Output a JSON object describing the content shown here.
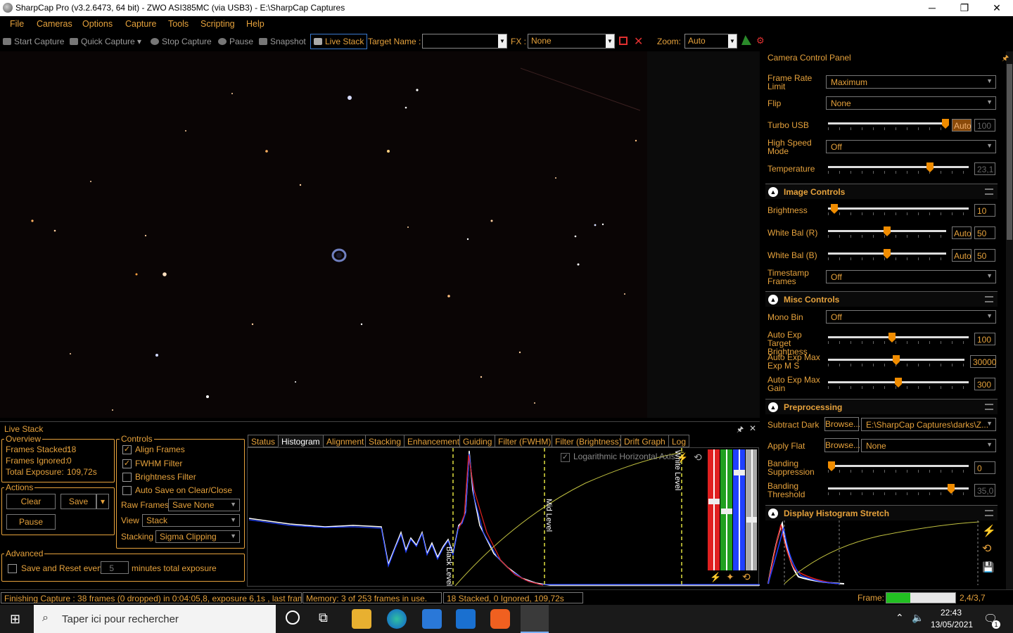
{
  "window": {
    "title": "SharpCap Pro (v3.2.6473, 64 bit) - ZWO ASI385MC (via USB3) - E:\\SharpCap Captures",
    "minimize": "─",
    "maximize": "❐",
    "close": "✕"
  },
  "menu": [
    "File",
    "Cameras",
    "Options",
    "Capture",
    "Tools",
    "Scripting",
    "Help"
  ],
  "toolbar": {
    "start_capture": "Start Capture",
    "quick_capture": "Quick Capture",
    "stop_capture": "Stop Capture",
    "pause": "Pause",
    "snapshot": "Snapshot",
    "live_stack": "Live Stack",
    "target_name_label": "Target Name :",
    "target_name_value": "",
    "fx_label": "FX :",
    "fx_value": "None",
    "zoom_label": "Zoom:",
    "zoom_value": "Auto"
  },
  "camera_panel": {
    "title": "Camera Control Panel",
    "frame_rate_label": "Frame Rate Limit",
    "frame_rate_value": "Maximum",
    "flip_label": "Flip",
    "flip_value": "None",
    "turbo_usb_label": "Turbo USB",
    "turbo_usb_auto": "Auto",
    "turbo_usb_value": "100",
    "turbo_usb_level": 0.95,
    "high_speed_label": "High Speed Mode",
    "high_speed_value": "Off",
    "temperature_label": "Temperature",
    "temperature_value": "23,1",
    "temperature_level": 0.73
  },
  "image_controls": {
    "title": "Image Controls",
    "brightness_label": "Brightness",
    "brightness_value": "10",
    "brightness_level": 0.04,
    "wb_r_label": "White Bal (R)",
    "wb_r_auto": "Auto",
    "wb_r_value": "50",
    "wb_b_label": "White Bal (B)",
    "wb_b_auto": "Auto",
    "wb_b_value": "50",
    "timestamp_label": "Timestamp Frames",
    "timestamp_value": "Off"
  },
  "misc_controls": {
    "title": "Misc Controls",
    "mono_bin_label": "Mono Bin",
    "mono_bin_value": "Off",
    "auto_exp_target_label": "Auto Exp Target Brightness",
    "auto_exp_target_value": "100",
    "auto_exp_max_ms_label": "Auto Exp Max Exp M S",
    "auto_exp_max_ms_value": "30000",
    "auto_exp_max_gain_label": "Auto Exp Max Gain",
    "auto_exp_max_gain_value": "300"
  },
  "preprocessing": {
    "title": "Preprocessing",
    "subtract_dark_label": "Subtract Dark",
    "browse1": "Browse...",
    "subtract_dark_value": "E:\\SharpCap Captures\\darks\\Z...",
    "apply_flat_label": "Apply Flat",
    "browse2": "Browse...",
    "apply_flat_value": "None",
    "banding_supp_label": "Banding Suppression",
    "banding_supp_value": "0",
    "banding_thresh_label": "Banding Threshold",
    "banding_thresh_value": "35,0"
  },
  "display_stretch": {
    "title": "Display Histogram Stretch"
  },
  "live_stack": {
    "title": "Live Stack",
    "pin": "🖈",
    "close": "✕",
    "overview": {
      "label": "Overview",
      "frames_stacked_label": "Frames Stacked:",
      "frames_stacked": "18",
      "frames_ignored_label": "Frames Ignored:",
      "frames_ignored": "0",
      "total_exposure_label": "Total Exposure:",
      "total_exposure": "109,72s"
    },
    "actions": {
      "label": "Actions",
      "clear": "Clear",
      "save": "Save",
      "pause": "Pause"
    },
    "controls": {
      "label": "Controls",
      "align_frames": "Align Frames",
      "fwhm_filter": "FWHM Filter",
      "brightness_filter": "Brightness Filter",
      "auto_save": "Auto Save on Clear/Close",
      "raw_frames_label": "Raw Frames",
      "raw_frames_value": "Save None",
      "view_label": "View",
      "view_value": "Stack",
      "stacking_label": "Stacking",
      "stacking_value": "Sigma Clipping"
    },
    "advanced": {
      "label": "Advanced",
      "save_reset_label": "Save and Reset every",
      "minutes_value": "5",
      "minutes_label": "minutes total exposure"
    },
    "tabs": [
      "Status",
      "Histogram",
      "Alignment",
      "Stacking",
      "Enhancement",
      "Guiding",
      "Filter (FWHM)",
      "Filter (Brightness)",
      "Drift Graph",
      "Log"
    ],
    "histogram": {
      "log_axis_label": "Logarithmic Horizontal Axis",
      "black_level": "Black Level",
      "mid_level": "Mid Level",
      "white_level": "White Level"
    }
  },
  "status": {
    "capture": "Finishing Capture : 38 frames (0 dropped) in 0:04:05,8, exposure 6,1s , last frame 6",
    "memory": "Memory: 3 of 253 frames in use.",
    "stacked": "18 Stacked, 0 Ignored, 109,72s",
    "frame_label": "Frame:",
    "frame_value": "2,4/3,7",
    "frame_progress": 0.35
  },
  "taskbar": {
    "search_placeholder": "Taper ici pour rechercher",
    "time": "22:43",
    "date": "13/05/2021",
    "notif_count": "1"
  },
  "colors": {
    "accent": "#e6a23c",
    "slider_thumb": "#f08c00",
    "progress_green": "#22c022"
  }
}
